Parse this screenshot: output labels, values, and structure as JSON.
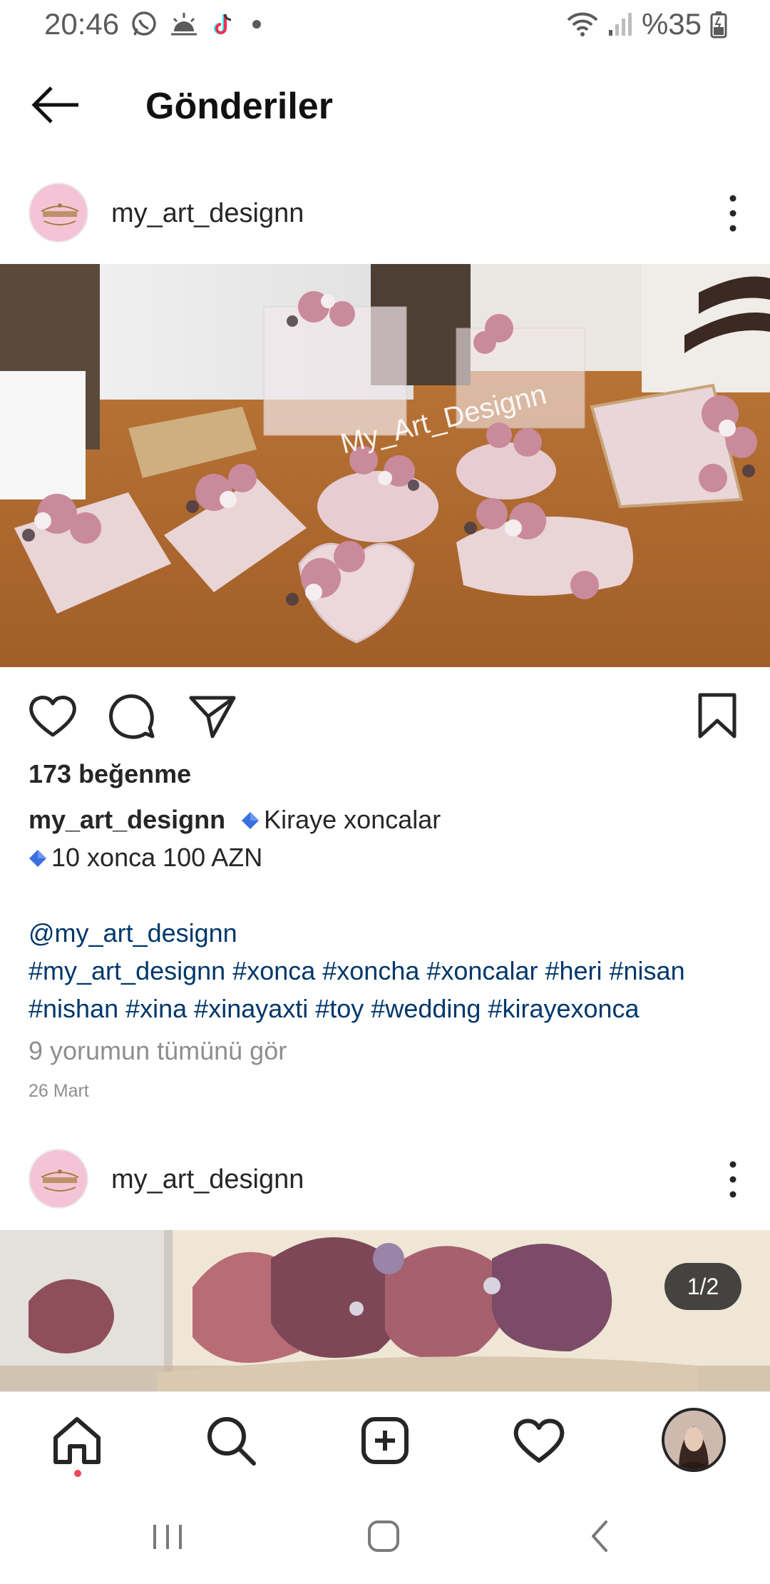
{
  "status_bar": {
    "time": "20:46",
    "battery": "%35",
    "icons": [
      "whatsapp-icon",
      "weather-icon",
      "tiktok-icon",
      "dot-icon",
      "wifi-icon",
      "signal-icon",
      "battery-icon"
    ]
  },
  "header": {
    "title": "Gönderiler"
  },
  "post1": {
    "username": "my_art_designn",
    "image_watermark": "My_Art_Designn",
    "likes": "173 beğenme",
    "caption_username": "my_art_designn",
    "caption_line1": "Kiraye xoncalar",
    "caption_line2": "10 xonca 100 AZN",
    "mention": "@my_art_designn",
    "hashtags_line1": "#my_art_designn #xonca #xoncha #xoncalar #heri #nisan",
    "hashtags_line2": "#nishan #xina #xinayaxti #toy #wedding #kirayexonca",
    "view_comments": "9 yorumun tümünü gör",
    "date": "26 Mart"
  },
  "post2": {
    "username": "my_art_designn",
    "image_counter": "1/2"
  },
  "bottom_nav": {
    "items": [
      "home-icon",
      "search-icon",
      "new-post-icon",
      "activity-icon",
      "profile-avatar"
    ]
  },
  "colors": {
    "hashtag": "#00376b",
    "muted": "#8e8e8e",
    "text": "#262626",
    "notification_dot": "#ed4956",
    "gem_blue": "#3b6fe0"
  }
}
